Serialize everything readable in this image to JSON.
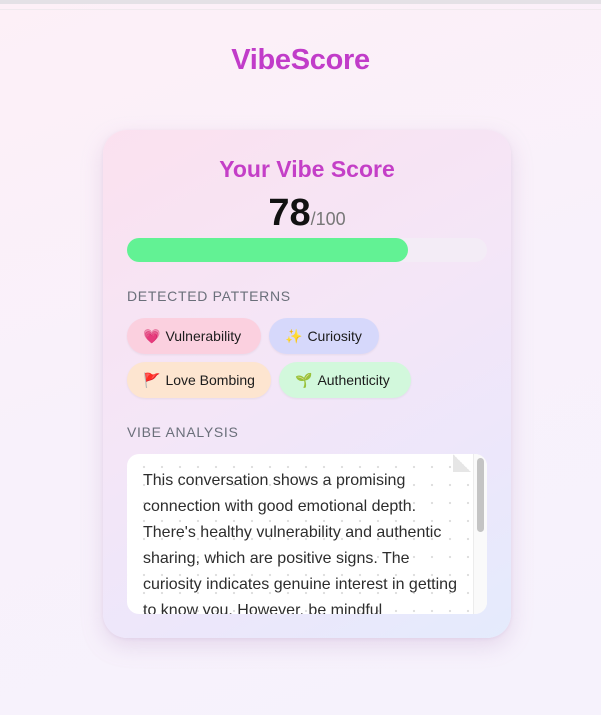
{
  "app": {
    "title": "VibeScore"
  },
  "card": {
    "title": "Your Vibe Score",
    "score": "78",
    "score_max": "/100",
    "progress": 0.78
  },
  "patterns": {
    "label": "DETECTED PATTERNS",
    "items": [
      {
        "emoji": "💗",
        "label": "Vulnerability",
        "color": "#fbd0df"
      },
      {
        "emoji": "✨",
        "label": "Curiosity",
        "color": "#d6d8fb"
      },
      {
        "emoji": "🚩",
        "label": "Love Bombing",
        "color": "#fde5d0"
      },
      {
        "emoji": "🌱",
        "label": "Authenticity",
        "color": "#d2f8dc"
      }
    ]
  },
  "analysis": {
    "label": "VIBE ANALYSIS",
    "text": "This conversation shows a promising connection with good emotional depth. There's healthy vulnerability and authentic sharing, which are positive signs. The curiosity indicates genuine interest in getting to know you. However, be mindful"
  },
  "colors": {
    "accent": "#c13cc9",
    "progress": "#62f294"
  }
}
